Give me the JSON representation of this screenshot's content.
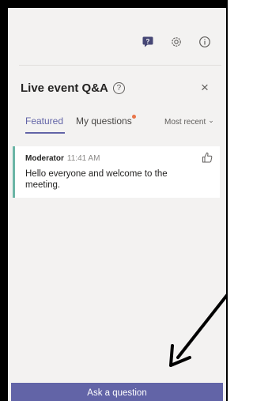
{
  "toolbar": {
    "icons": [
      "chat-question-icon",
      "settings-gear-icon",
      "info-icon"
    ]
  },
  "header": {
    "title": "Live event Q&A",
    "help_icon": "question-circle-icon",
    "close_icon": "close-icon",
    "close_glyph": "×"
  },
  "tabs": {
    "featured": "Featured",
    "my_questions": "My questions",
    "my_questions_has_notification": true,
    "sort_label": "Most recent",
    "sort_chevron": "⌄"
  },
  "questions": [
    {
      "author": "Moderator",
      "time": "11:41 AM",
      "text": "Hello everyone and welcome to the meeting.",
      "like_icon": "thumbs-up-icon"
    }
  ],
  "footer": {
    "ask_label": "Ask a question"
  },
  "colors": {
    "accent": "#6264a7",
    "notification_dot": "#e97548",
    "card_accent": "#6bb5a6",
    "panel_background": "#f3f2f1"
  }
}
